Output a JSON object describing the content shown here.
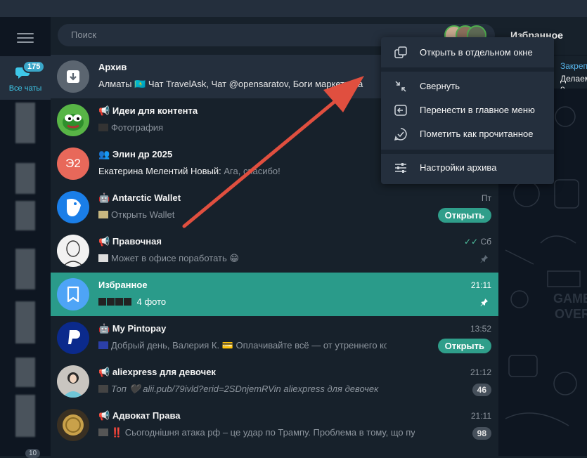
{
  "search": {
    "placeholder": "Поиск"
  },
  "folders": {
    "all_chats_label": "Все чаты",
    "all_chats_badge": "175",
    "bottom_badge": "10"
  },
  "chats": [
    {
      "title": "Архив",
      "preview": "Алматы 🇰🇿 Чат TravelAsk, Чат @opensaratov, Боги маркетинга"
    },
    {
      "title": "Идеи для контента",
      "preview": "Фотография"
    },
    {
      "title": "Элин др 2025",
      "sender": "Екатерина Мелентий Новый:",
      "preview": "Ага, спасибо!"
    },
    {
      "title": "Antarctic Wallet",
      "time": "Пт",
      "preview": "Открыть Wallet",
      "button": "Открыть"
    },
    {
      "title": "Правочная",
      "time": "Сб",
      "preview": "Может в офисе поработать 😁"
    },
    {
      "title": "Избранное",
      "time": "21:11",
      "preview": "4 фото"
    },
    {
      "title": "My Pintopay",
      "time": "13:52",
      "preview": "Добрый день, Валерия К. 💳 Оплачивайте всё — от утреннего кофе до о",
      "button": "Открыть"
    },
    {
      "title": "aliexpress для девочек",
      "time": "21:12",
      "preview": "Топ 🖤 alii.pub/79ivld?erid=2SDnjemRVin  aliexpress для девочек",
      "count": "46"
    },
    {
      "title": "Адвокат Права",
      "time": "21:11",
      "preview": "‼️ Сьогоднішня атака рф – це удар по Трампу. Проблема в тому, що путін не б...",
      "count": "98"
    }
  ],
  "avatar_text": {
    "elin": "Э2"
  },
  "right_panel": {
    "title": "Избранное",
    "pinned_title": "Закреплё",
    "pinned_preview": "Делаем о"
  },
  "context_menu": {
    "open_new_window": "Открыть в отдельном окне",
    "collapse": "Свернуть",
    "move_to_main": "Перенести в главное меню",
    "mark_read": "Пометить как прочитанное",
    "archive_settings": "Настройки архива"
  },
  "colors": {
    "accent": "#2a9b8a",
    "arrow": "#e04f3f",
    "bg": "#17212b"
  }
}
